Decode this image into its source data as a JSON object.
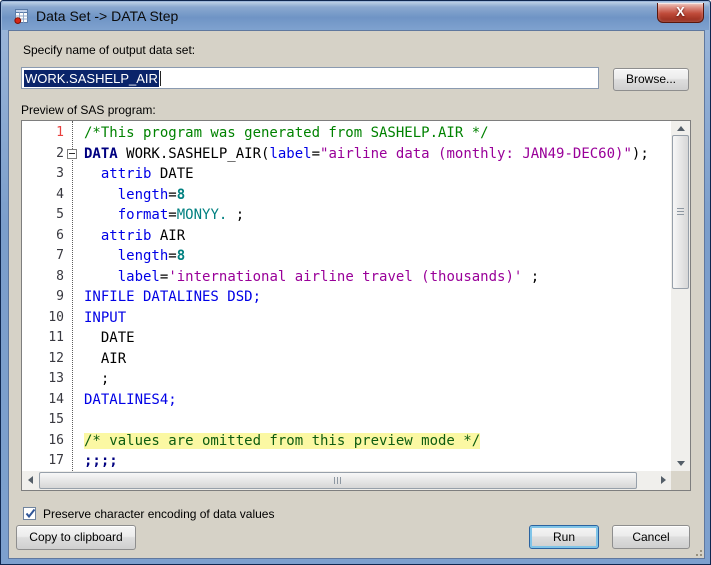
{
  "window": {
    "title": "Data Set -> DATA Step",
    "close_glyph": "X"
  },
  "form": {
    "output_label": "Specify name of output data set:",
    "output_value": "WORK.SASHELP_AIR",
    "browse_label": "Browse...",
    "preview_label": "Preview of SAS program:"
  },
  "editor": {
    "current_line": 1,
    "lines": [
      {
        "num": 1,
        "collapse": false,
        "tokens": [
          {
            "text": "/*This program was generated from SASHELP.AIR */",
            "style": "comment"
          }
        ]
      },
      {
        "num": 2,
        "collapse": true,
        "tokens": [
          {
            "text": "DATA",
            "style": "datastep"
          },
          {
            "text": " WORK.SASHELP_AIR(",
            "style": "plain"
          },
          {
            "text": "label",
            "style": "keyword"
          },
          {
            "text": "=",
            "style": "plain"
          },
          {
            "text": "\"airline data (monthly: JAN49-DEC60)\"",
            "style": "string"
          },
          {
            "text": ");",
            "style": "plain"
          }
        ]
      },
      {
        "num": 3,
        "collapse": false,
        "tokens": [
          {
            "text": "  ",
            "style": "plain"
          },
          {
            "text": "attrib",
            "style": "keyword"
          },
          {
            "text": " DATE",
            "style": "plain"
          }
        ]
      },
      {
        "num": 4,
        "collapse": false,
        "tokens": [
          {
            "text": "    ",
            "style": "plain"
          },
          {
            "text": "length",
            "style": "keyword"
          },
          {
            "text": "=",
            "style": "plain"
          },
          {
            "text": "8",
            "style": "number"
          }
        ]
      },
      {
        "num": 5,
        "collapse": false,
        "tokens": [
          {
            "text": "    ",
            "style": "plain"
          },
          {
            "text": "format",
            "style": "keyword"
          },
          {
            "text": "=",
            "style": "plain"
          },
          {
            "text": "MONYY.",
            "style": "format"
          },
          {
            "text": " ;",
            "style": "plain"
          }
        ]
      },
      {
        "num": 6,
        "collapse": false,
        "tokens": [
          {
            "text": "  ",
            "style": "plain"
          },
          {
            "text": "attrib",
            "style": "keyword"
          },
          {
            "text": " AIR",
            "style": "plain"
          }
        ]
      },
      {
        "num": 7,
        "collapse": false,
        "tokens": [
          {
            "text": "    ",
            "style": "plain"
          },
          {
            "text": "length",
            "style": "keyword"
          },
          {
            "text": "=",
            "style": "plain"
          },
          {
            "text": "8",
            "style": "number"
          }
        ]
      },
      {
        "num": 8,
        "collapse": false,
        "tokens": [
          {
            "text": "    ",
            "style": "plain"
          },
          {
            "text": "label",
            "style": "keyword"
          },
          {
            "text": "=",
            "style": "plain"
          },
          {
            "text": "'international airline travel (thousands)'",
            "style": "string"
          },
          {
            "text": " ;",
            "style": "plain"
          }
        ]
      },
      {
        "num": 9,
        "collapse": false,
        "tokens": [
          {
            "text": "INFILE DATALINES DSD;",
            "style": "keyword"
          }
        ]
      },
      {
        "num": 10,
        "collapse": false,
        "tokens": [
          {
            "text": "INPUT",
            "style": "keyword"
          }
        ]
      },
      {
        "num": 11,
        "collapse": false,
        "tokens": [
          {
            "text": "  DATE",
            "style": "plain"
          }
        ]
      },
      {
        "num": 12,
        "collapse": false,
        "tokens": [
          {
            "text": "  AIR",
            "style": "plain"
          }
        ]
      },
      {
        "num": 13,
        "collapse": false,
        "tokens": [
          {
            "text": "  ;",
            "style": "plain"
          }
        ]
      },
      {
        "num": 14,
        "collapse": false,
        "tokens": [
          {
            "text": "DATALINES4;",
            "style": "keyword"
          }
        ]
      },
      {
        "num": 15,
        "collapse": false,
        "tokens": []
      },
      {
        "num": 16,
        "collapse": false,
        "tokens": [
          {
            "text": "/* values are omitted from this preview mode */",
            "style": "comment-hl"
          }
        ]
      },
      {
        "num": 17,
        "collapse": false,
        "tokens": [
          {
            "text": ";;;;",
            "style": "semis"
          }
        ]
      }
    ]
  },
  "footer": {
    "checkbox_label": "Preserve character encoding of data values",
    "checkbox_checked": true,
    "copy_label": "Copy to clipboard",
    "run_label": "Run",
    "cancel_label": "Cancel"
  },
  "colors": {
    "comment": "#008200",
    "datastep": "#000080",
    "keyword": "#0000e6",
    "number": "#008080",
    "format": "#008080",
    "string": "#990099",
    "plain": "#000000",
    "comment-hl": "#0e5c10",
    "comment-hl-bg": "#fbf8a3",
    "semis": "#000080",
    "line-number": "#38383f",
    "current-line-number": "#e8403e",
    "selection-bg": "#0a246a"
  }
}
